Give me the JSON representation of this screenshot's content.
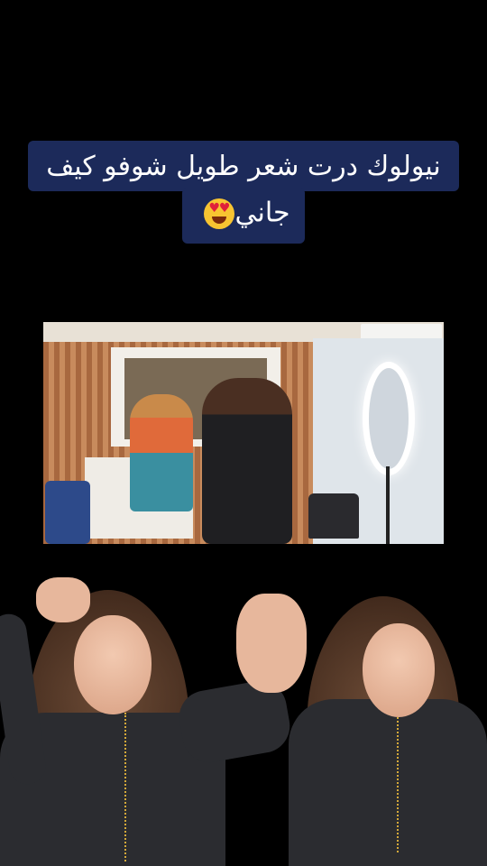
{
  "caption": {
    "line1": "نيولوك درت شعر طويل شوفو كيف",
    "line2": "جاني",
    "emoji": "smiling-face-with-heart-eyes-emoji"
  },
  "photo": {
    "scene": "salon-interior"
  },
  "colors": {
    "caption_bg": "#1c2a5a",
    "caption_text": "#ffffff",
    "background": "#000000"
  }
}
